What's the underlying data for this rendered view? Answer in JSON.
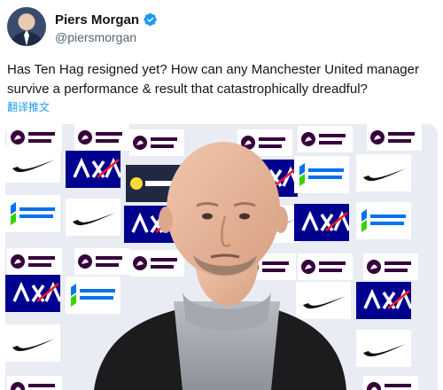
{
  "author": {
    "display_name": "Piers Morgan",
    "handle": "@piersmorgan",
    "avatar_icon": "profile-photo-icon",
    "verified_icon": "verified-badge-icon"
  },
  "tweet": {
    "text": "Has Ten Hag resigned yet? How can any Manchester United manager survive a performance & result that catastrophically dreadful?",
    "translate_label": "翻译推文"
  },
  "media": {
    "kind": "photo",
    "backdrop_sponsors": [
      "Premier League",
      "AXA",
      "Expedia",
      "standard chartered",
      "Nike"
    ],
    "sponsor_icons": [
      "premier-league-lion-icon",
      "axa-logo-icon",
      "nike-swoosh-icon",
      "standard-chartered-logo-icon",
      "expedia-logo-icon"
    ]
  },
  "colors": {
    "accent": "#1d9bf0",
    "text": "#0f1419",
    "secondary_text": "#536471",
    "axa_blue": "#00008f",
    "premier_purple": "#37003c"
  }
}
